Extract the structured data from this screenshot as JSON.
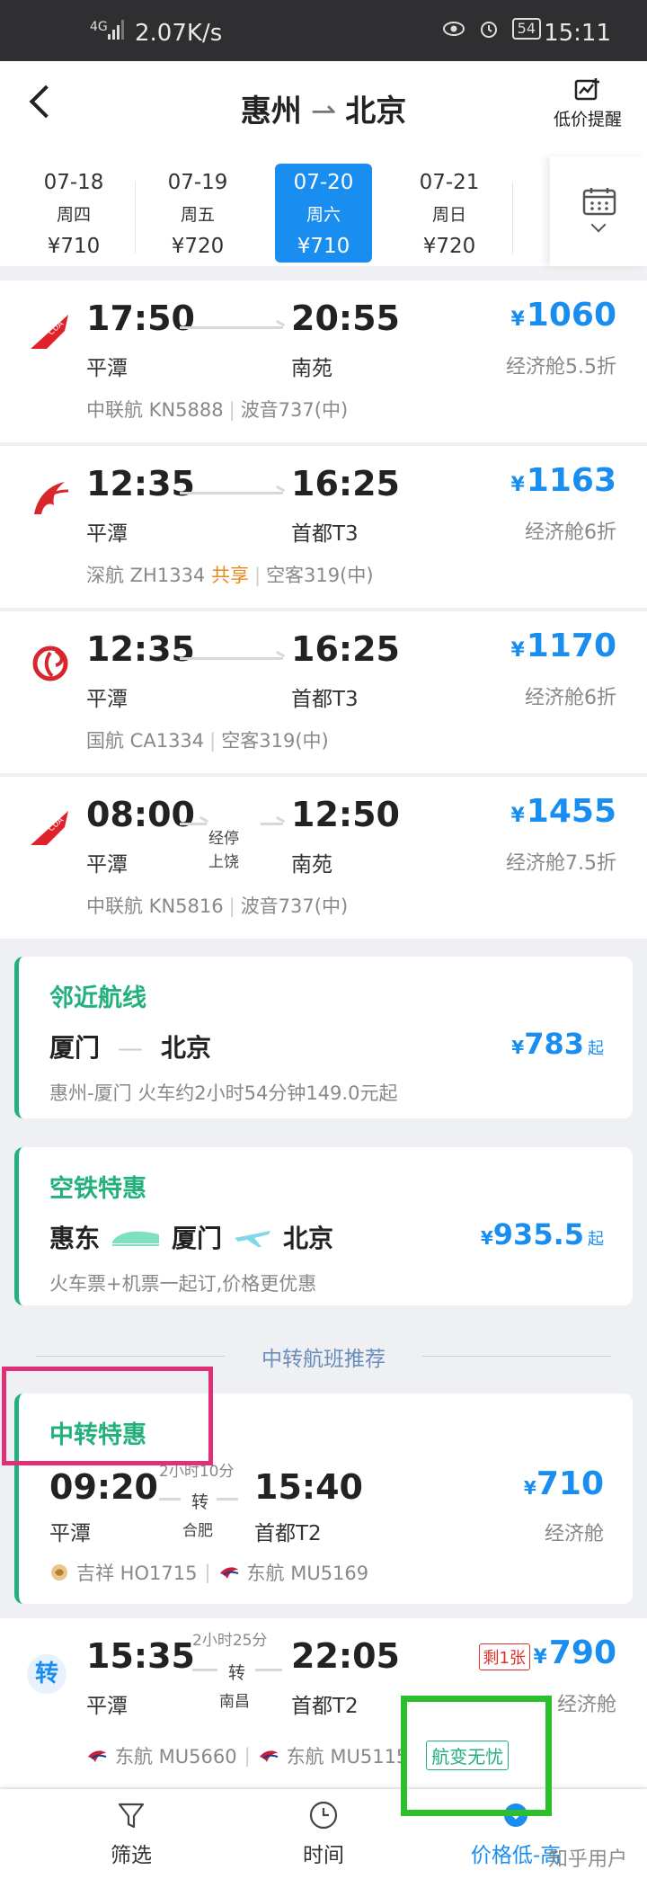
{
  "status": {
    "net_speed": "2.07K/s",
    "signal": "4G",
    "battery": "54",
    "time": "15:11"
  },
  "header": {
    "from": "惠州",
    "to": "北京",
    "price_alert": "低价提醒"
  },
  "dates": [
    {
      "date": "07-18",
      "weekday": "周四",
      "price": "¥710"
    },
    {
      "date": "07-19",
      "weekday": "周五",
      "price": "¥720"
    },
    {
      "date": "07-20",
      "weekday": "周六",
      "price": "¥710",
      "active": true
    },
    {
      "date": "07-21",
      "weekday": "周日",
      "price": "¥720"
    }
  ],
  "flights": [
    {
      "dep": "17:50",
      "dep_airport": "平潭",
      "arr": "20:55",
      "arr_airport": "南苑",
      "price": "1060",
      "cabin": "经济舱5.5折",
      "airline": "中联航 KN5888",
      "aircraft": "波音737(中)",
      "share": "",
      "stop": "",
      "stop_city": ""
    },
    {
      "dep": "12:35",
      "dep_airport": "平潭",
      "arr": "16:25",
      "arr_airport": "首都T3",
      "price": "1163",
      "cabin": "经济舱6折",
      "airline": "深航 ZH1334",
      "aircraft": "空客319(中)",
      "share": "共享",
      "stop": "",
      "stop_city": ""
    },
    {
      "dep": "12:35",
      "dep_airport": "平潭",
      "arr": "16:25",
      "arr_airport": "首都T3",
      "price": "1170",
      "cabin": "经济舱6折",
      "airline": "国航 CA1334",
      "aircraft": "空客319(中)",
      "share": "",
      "stop": "",
      "stop_city": ""
    },
    {
      "dep": "08:00",
      "dep_airport": "平潭",
      "arr": "12:50",
      "arr_airport": "南苑",
      "price": "1455",
      "cabin": "经济舱7.5折",
      "airline": "中联航 KN5816",
      "aircraft": "波音737(中)",
      "share": "",
      "stop": "经停",
      "stop_city": "上饶"
    }
  ],
  "currency": "¥",
  "nearby": {
    "title": "邻近航线",
    "from": "厦门",
    "to": "北京",
    "price": "783",
    "qi": "起",
    "desc": "惠州-厦门 火车约2小时54分钟149.0元起"
  },
  "railair": {
    "title": "空铁特惠",
    "c1": "惠东",
    "c2": "厦门",
    "c3": "北京",
    "price": "935.5",
    "qi": "起",
    "desc": "火车票+机票一起订,价格更优惠"
  },
  "divider": "中转航班推荐",
  "transfer1": {
    "title": "中转特惠",
    "dep": "09:20",
    "dep_airport": "平潭",
    "duration": "2小时10分",
    "zhuan": "转",
    "via": "合肥",
    "arr": "15:40",
    "arr_airport": "首都T2",
    "price": "710",
    "cabin": "经济舱",
    "seg1": "吉祥 HO1715",
    "seg2": "东航 MU5169"
  },
  "transfer2": {
    "badge": "转",
    "dep": "15:35",
    "dep_airport": "平潭",
    "duration": "2小时25分",
    "zhuan": "转",
    "via": "南昌",
    "arr": "22:05",
    "arr_airport": "首都T2",
    "remain": "剩1张",
    "price": "790",
    "cabin": "经济舱",
    "seg1": "东航 MU5660",
    "seg2": "东航 MU5115",
    "tag": "航变无忧"
  },
  "tabs": {
    "filter": "筛选",
    "time": "时间",
    "price": "价格低-高"
  },
  "watermark": "知乎用户",
  "colors": {
    "accent": "#1a8ef0",
    "green": "#22b07d",
    "share": "#e88a1a"
  }
}
